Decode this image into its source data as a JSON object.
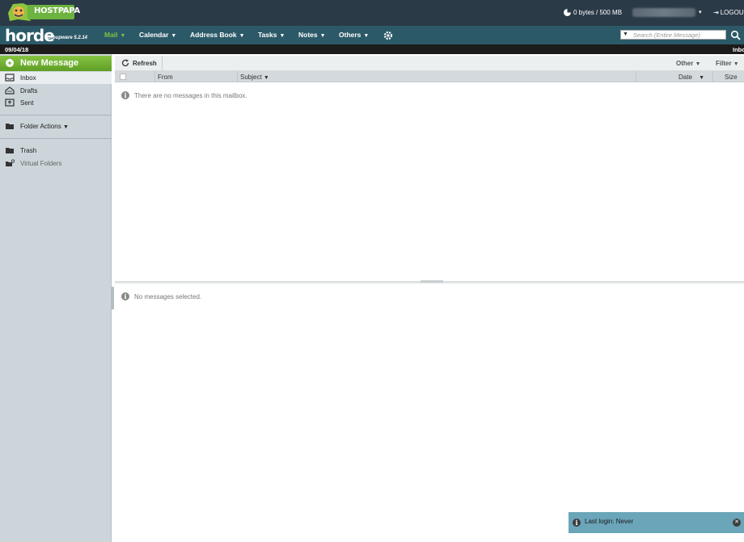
{
  "branding": {
    "hostpapa": "HOSTPAPA",
    "horde": "horde",
    "horde_sub": "Groupware 5.2.14"
  },
  "topbar": {
    "quota": "0 bytes / 500 MB",
    "logout": "LOGOU"
  },
  "nav": {
    "items": [
      {
        "label": "Mail",
        "active": true
      },
      {
        "label": "Calendar"
      },
      {
        "label": "Address Book"
      },
      {
        "label": "Tasks"
      },
      {
        "label": "Notes"
      },
      {
        "label": "Others"
      }
    ],
    "search_placeholder": "Search (Entire Message)",
    "accent_color": "#7fc241"
  },
  "datebar": {
    "date": "09/04/18",
    "breadcrumb_right": "Inbo"
  },
  "sidebar": {
    "new_message": "New Message",
    "folders": [
      {
        "label": "Inbox",
        "icon": "inbox-icon",
        "selected": true
      },
      {
        "label": "Drafts",
        "icon": "drafts-icon"
      },
      {
        "label": "Sent",
        "icon": "sent-icon"
      }
    ],
    "folder_actions": "Folder Actions",
    "trash": "Trash",
    "virtual_folders": "Virtual Folders"
  },
  "toolbar": {
    "refresh": "Refresh",
    "other": "Other",
    "filter": "Filter"
  },
  "columns": {
    "from": "From",
    "subject": "Subject",
    "date": "Date",
    "size": "Size"
  },
  "messages": {
    "empty": "There are no messages in this mailbox.",
    "preview_empty": "No messages selected."
  },
  "notification": {
    "text": "Last login: Never"
  }
}
